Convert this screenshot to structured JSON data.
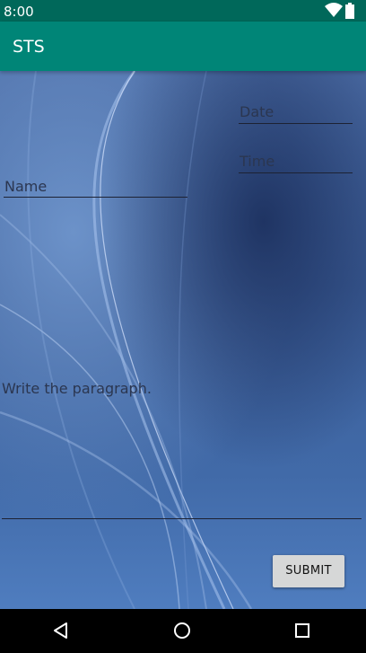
{
  "status_bar": {
    "time": "8:00",
    "icons": [
      "wifi-icon",
      "battery-icon"
    ]
  },
  "app_bar": {
    "title": "STS"
  },
  "form": {
    "date_hint": "Date",
    "time_hint": "Time",
    "name_hint": "Name",
    "paragraph_hint": "Write the paragraph.",
    "submit_label": "SUBMIT"
  },
  "nav_bar": {
    "icons": [
      "back-icon",
      "home-icon",
      "recents-icon"
    ]
  },
  "colors": {
    "status_bar": "#00685a",
    "app_bar": "#008577",
    "button": "#d6d7d7"
  }
}
